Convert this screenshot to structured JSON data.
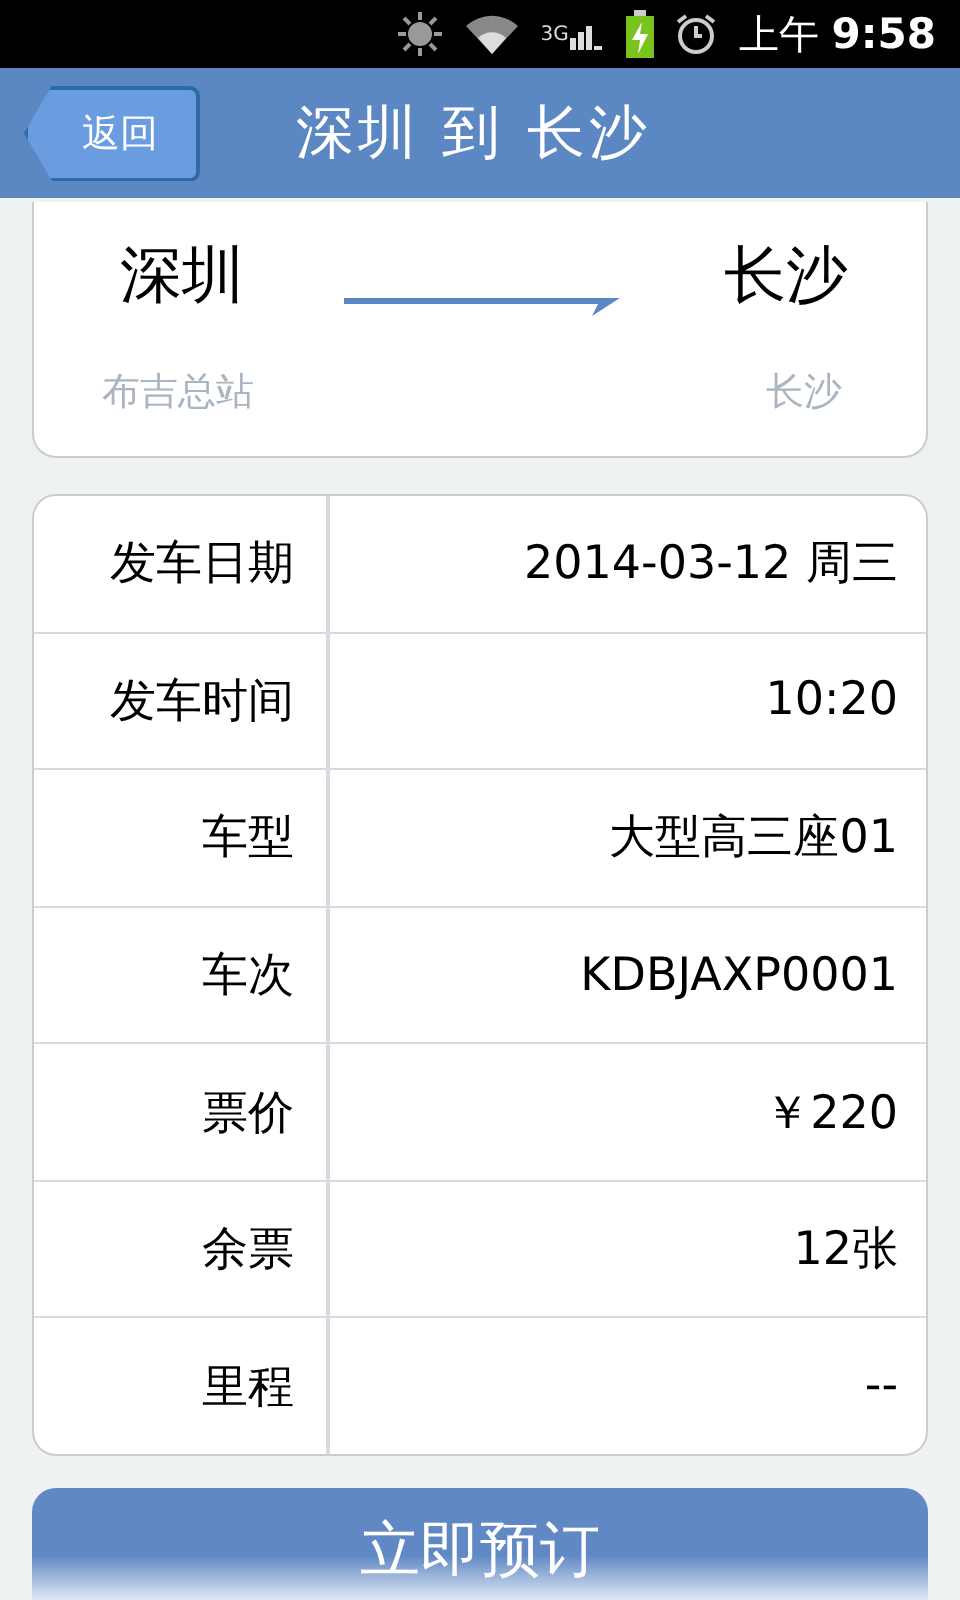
{
  "status_bar": {
    "time_prefix": "上午",
    "time": "9:58",
    "network": "3G"
  },
  "header": {
    "back": "返回",
    "title": "深圳 到 长沙"
  },
  "route": {
    "from": "深圳",
    "to": "长沙",
    "from_station": "布吉总站",
    "to_station": "长沙"
  },
  "details": [
    {
      "label": "发车日期",
      "value": "2014-03-12 周三"
    },
    {
      "label": "发车时间",
      "value": "10:20"
    },
    {
      "label": "车型",
      "value": "大型高三座01"
    },
    {
      "label": "车次",
      "value": "KDBJAXP0001"
    },
    {
      "label": "票价",
      "value": "￥220"
    },
    {
      "label": "余票",
      "value": "12张"
    },
    {
      "label": "里程",
      "value": "--"
    }
  ],
  "book_button": "立即预订"
}
